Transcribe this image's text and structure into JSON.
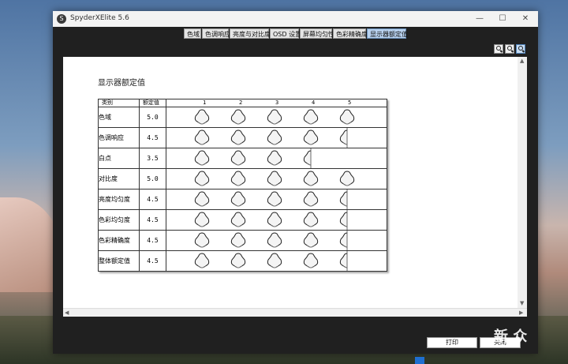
{
  "window": {
    "title": "SpyderXElite 5.6",
    "minimize": "—",
    "maximize": "☐",
    "close": "✕"
  },
  "tabs": [
    {
      "label": "色域",
      "active": false
    },
    {
      "label": "色调响应",
      "active": false
    },
    {
      "label": "亮度与对比度",
      "active": false
    },
    {
      "label": "OSD 设置",
      "active": false
    },
    {
      "label": "屏幕均匀性",
      "active": false
    },
    {
      "label": "色彩精确度",
      "active": false
    },
    {
      "label": "显示器额定值",
      "active": true
    }
  ],
  "zoom_buttons": [
    "zoom-in-icon",
    "zoom-out-icon",
    "zoom-fit-icon"
  ],
  "report": {
    "title": "显示器额定值",
    "col_category": "类别",
    "col_score": "额定值",
    "scale": [
      "1",
      "2",
      "3",
      "4",
      "5"
    ],
    "rows": [
      {
        "category": "色域",
        "score": "5.0",
        "value": 5.0
      },
      {
        "category": "色调响应",
        "score": "4.5",
        "value": 4.5
      },
      {
        "category": "白点",
        "score": "3.5",
        "value": 3.5
      },
      {
        "category": "对比度",
        "score": "5.0",
        "value": 5.0
      },
      {
        "category": "亮度均匀度",
        "score": "4.5",
        "value": 4.5
      },
      {
        "category": "色彩均匀度",
        "score": "4.5",
        "value": 4.5
      },
      {
        "category": "色彩精确度",
        "score": "4.5",
        "value": 4.5
      },
      {
        "category": "整体额定值",
        "score": "4.5",
        "value": 4.5
      }
    ]
  },
  "buttons": {
    "print": "打印",
    "second": "关闭"
  },
  "watermark": "新 众",
  "colors": {
    "tab_active": "#b9d2ef",
    "window_bg": "#202020"
  }
}
